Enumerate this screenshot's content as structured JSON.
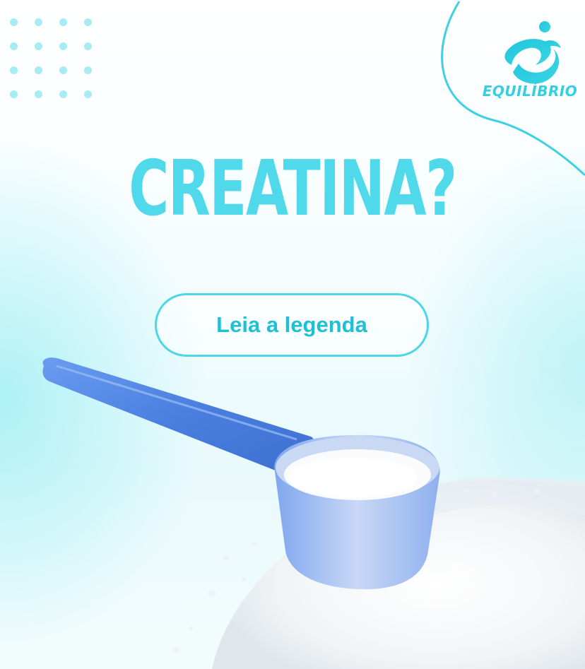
{
  "brand": {
    "name": "EQUILÍBRIO",
    "logo_icon": "runner-swirl-icon",
    "accent_color": "#34cfe0"
  },
  "headline": "CREATINA?",
  "cta": {
    "label": "Leia a legenda"
  },
  "decor": {
    "dot_grid": "dot-grid-decoration",
    "corner": "corner-arc-decoration"
  },
  "illustration": {
    "subject": "scoop-with-powder",
    "scoop_color": "#4f86e6",
    "powder_color": "#f4f6f8"
  },
  "colors": {
    "headline": "#4fd9ea",
    "button_border": "#4cd6e6",
    "button_text": "#20c0d4"
  }
}
